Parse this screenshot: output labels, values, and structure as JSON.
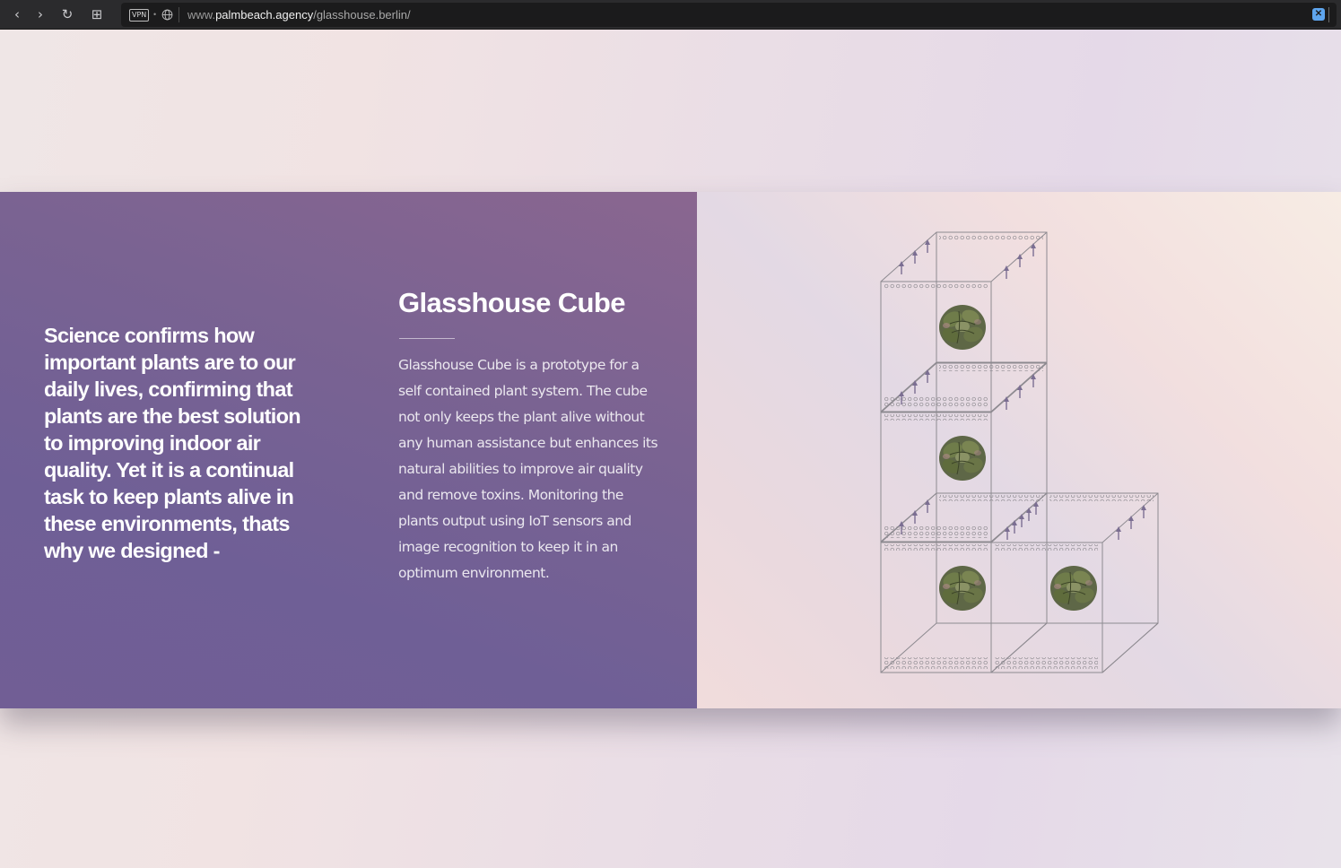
{
  "browser": {
    "back_icon": "‹",
    "forward_icon": "›",
    "reload_icon": "↻",
    "tabs_icon": "⊞",
    "vpn_label": "VPN",
    "url_prefix": "www.",
    "url_host": "palmbeach.agency",
    "url_path": "/glasshouse.berlin/",
    "shield_label": "✕"
  },
  "intro": {
    "text": "Science confirms how important plants are to our daily lives, confirming that plants are the best solution to improving indoor air quality. Yet it is a continual task to keep plants alive in these environments, thats why we designed -"
  },
  "product": {
    "title": "Glasshouse Cube",
    "description": "Glasshouse Cube is a prototype for a self contained plant system. The cube not only keeps the plant alive without any human assistance but enhances its natural abilities to improve air quality and remove toxins. Monitoring the plants output using IoT sensors and image recognition to keep it in an optimum environment."
  },
  "colors": {
    "panel_purple": "#75619a",
    "cube_line": "#8d8a90",
    "plant_green": "#5b6b3e"
  }
}
